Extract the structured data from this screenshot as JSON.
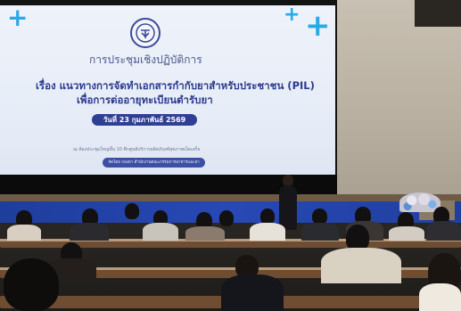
{
  "photo": {
    "slide": {
      "subtitle": "การประชุมเชิงปฏิบัติการ",
      "title_line1": "เรื่อง แนวทางการจัดทำเอกสารกำกับยาสำหรับประชาชน (PIL)",
      "title_line2": "เพื่อการต่ออายุทะเบียนตำรับยา",
      "date": "วันที่ 23 กุมภาพันธ์ 2569",
      "venue": "ณ ห้องประชุมใหญ่ชั้น 10 ตึกศูนย์บริการผลิตภัณฑ์สุขภาพเบ็ดเสร็จ",
      "organizer": "จัดโดย กองยา สำนักงานคณะกรรมการอาหารและยา",
      "accent_color": "#29a9e8",
      "title_color": "#2b3a8c"
    },
    "icons": [
      "plus-decoration-icon",
      "fda-logo-icon"
    ]
  }
}
